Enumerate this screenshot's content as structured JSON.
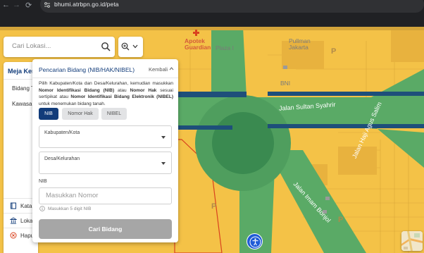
{
  "browser": {
    "url": "bhumi.atrbpn.go.id/peta"
  },
  "search": {
    "placeholder": "Cari Lokasi..."
  },
  "map": {
    "labels": {
      "pullman": "Pullman\nJakarta",
      "apotek": "Apotek\nGuardian",
      "plaza": "Plaza I",
      "bni": "BNI",
      "sultan": "Jalan Sultan Syahrir",
      "agus": "Jalan Haji Agus Salim",
      "imam": "Jalan Imam Bonjol"
    },
    "colors": {
      "parcel": "#f4c247",
      "road": "#5aaa66",
      "road_dark": "#2c6e4a",
      "highlight_outline": "#d9421f"
    }
  },
  "workspace": {
    "title": "Meja Kerj",
    "items": [
      "Bidang Ta",
      "Kawasan"
    ],
    "bottom": [
      "Katal",
      "Lokas",
      "Hapu"
    ]
  },
  "parcel_search": {
    "title": "Pencarian Bidang (NIB/HAK/NIBEL)",
    "back_label": "Kembali",
    "desc_1": "Pilih Kabupaten/Kota dan Desa/Kelurahan, kemudian masukkan ",
    "desc_b1": "Nomor Identifikasi Bidang (NIB)",
    "desc_2": " atau ",
    "desc_b2": "Nomor Hak",
    "desc_3": " sesuai sertipikat atau ",
    "desc_b3": "Nomor Identifikasi Bidang Elektronik (NIBEL)",
    "desc_4": " untuk menemukan bidang tanah.",
    "tabs": [
      "NIB",
      "Nomor Hak",
      "NIBEL"
    ],
    "active_tab": "NIB",
    "kabupaten_label": "Kabupaten/Kota",
    "desa_label": "Desa/Kelurahan",
    "nib_label": "NIB",
    "nib_placeholder": "Masukkan Nomor",
    "nib_hint": "Masukkan 5 digit NIB",
    "submit_label": "Cari Bidang"
  }
}
